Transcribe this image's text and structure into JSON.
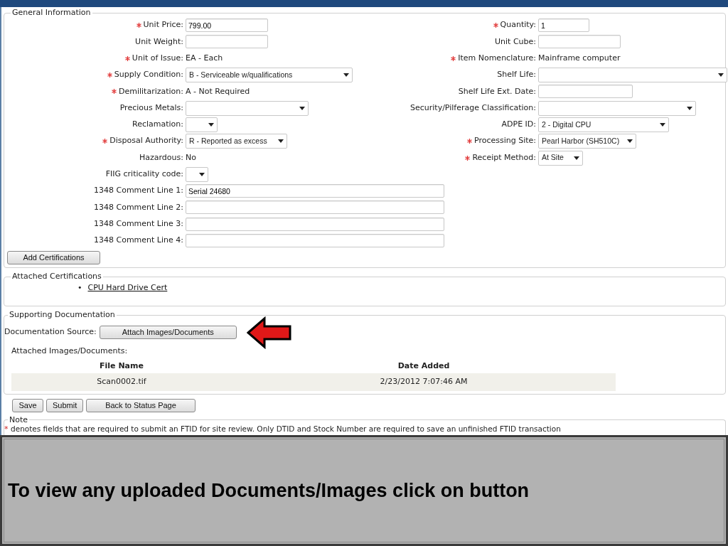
{
  "general": {
    "legend": "General Information",
    "left_fields": [
      {
        "label": "Unit Price:",
        "required": true,
        "kind": "input",
        "value": "799.00"
      },
      {
        "label": "Unit Weight:",
        "required": false,
        "kind": "input"
      },
      {
        "label": "Unit of Issue:",
        "required": true,
        "kind": "text",
        "value": "EA - Each"
      },
      {
        "label": "Supply Condition:",
        "required": true,
        "kind": "select",
        "value": "B - Serviceable w/qualifications"
      },
      {
        "label": "Demilitarization:",
        "required": true,
        "kind": "text",
        "value": "A - Not Required"
      },
      {
        "label": "Precious Metals:",
        "required": false,
        "kind": "select"
      },
      {
        "label": "Reclamation:",
        "required": false,
        "kind": "select"
      },
      {
        "label": "Disposal Authority:",
        "required": true,
        "kind": "select",
        "value": "R - Reported as excess"
      },
      {
        "label": "Hazardous:",
        "required": false,
        "kind": "text",
        "value": "No"
      },
      {
        "label": "FIIG criticality code:",
        "required": false,
        "kind": "select"
      },
      {
        "label": "1348 Comment Line 1:",
        "required": false,
        "kind": "input",
        "value": "Serial 24680"
      },
      {
        "label": "1348 Comment Line 2:",
        "required": false,
        "kind": "input"
      },
      {
        "label": "1348 Comment Line 3:",
        "required": false,
        "kind": "input"
      },
      {
        "label": "1348 Comment Line 4:",
        "required": false,
        "kind": "input"
      }
    ],
    "right_fields": [
      {
        "label": "Quantity:",
        "required": true,
        "kind": "input",
        "value": "1"
      },
      {
        "label": "Unit Cube:",
        "required": false,
        "kind": "input"
      },
      {
        "label": "Item Nomenclature:",
        "required": true,
        "kind": "text",
        "value": "Mainframe computer"
      },
      {
        "label": "Shelf Life:",
        "required": false,
        "kind": "select"
      },
      {
        "label": "Shelf Life Ext. Date:",
        "required": false,
        "kind": "input"
      },
      {
        "label": "Security/Pilferage Classification:",
        "required": false,
        "kind": "select"
      },
      {
        "label": "ADPE ID:",
        "required": false,
        "kind": "select",
        "value": "2 - Digital CPU"
      },
      {
        "label": "Processing Site:",
        "required": true,
        "kind": "select",
        "value": "Pearl Harbor (SH510C)"
      },
      {
        "label": "Receipt Method:",
        "required": true,
        "kind": "select",
        "value": "At Site"
      }
    ],
    "button": "Add Certifications"
  },
  "certifications": {
    "legend": "Attached Certifications",
    "items": [
      {
        "bullet": "•",
        "title": "CPU Hard Drive Cert"
      }
    ]
  },
  "documentation": {
    "legend": "Supporting Documentation",
    "source_label": "Documentation Source:",
    "attach_button": "Attach Images/Documents",
    "attached_label": "Attached Images/Documents:",
    "table": {
      "columns": [
        "File Name",
        "Date Added"
      ],
      "rows": [
        [
          "Scan0002.tif",
          "2/23/2012 7:07:46 AM"
        ]
      ]
    }
  },
  "buttons": [
    "Save",
    "Submit",
    "Back to Status Page"
  ],
  "note": {
    "legend": "Note",
    "marker": "*",
    "text": "denotes fields that are required to submit an FTID for site review. Only DTID and Stock Number are required to save an unfinished FTID transaction"
  },
  "caption": "To view any uploaded Documents/Images click on button"
}
